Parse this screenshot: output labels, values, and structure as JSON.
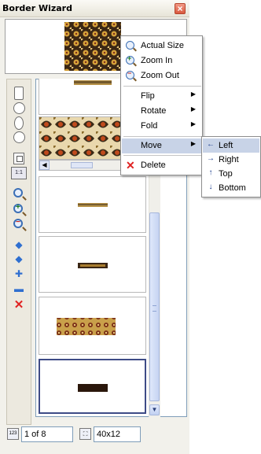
{
  "window": {
    "title": "Border Wizard"
  },
  "menu": {
    "items": [
      {
        "label": "Actual Size",
        "icon": "actual-size-icon"
      },
      {
        "label": "Zoom In",
        "icon": "zoom-in-icon"
      },
      {
        "label": "Zoom Out",
        "icon": "zoom-out-icon"
      },
      {
        "label": "Flip"
      },
      {
        "label": "Rotate"
      },
      {
        "label": "Fold"
      },
      {
        "label": "Move"
      },
      {
        "label": "Delete",
        "icon": "delete-icon"
      }
    ],
    "submenu_arrow": "▶"
  },
  "submenu": {
    "items": [
      {
        "label": "Left",
        "arrow": "←"
      },
      {
        "label": "Right",
        "arrow": "→"
      },
      {
        "label": "Top",
        "arrow": "↑"
      },
      {
        "label": "Bottom",
        "arrow": "↓"
      }
    ]
  },
  "status": {
    "page": "1 of 8",
    "size": "40x12",
    "page_icon_text": "123",
    "one_to_one": "1:1"
  },
  "colors": {
    "highlight": "#c8d3e7",
    "selected_border": "#3e4b86",
    "delete_red": "#e02222"
  }
}
